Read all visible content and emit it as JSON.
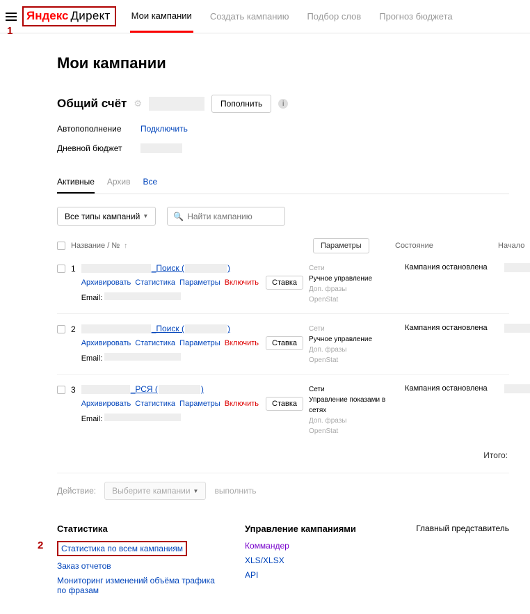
{
  "markers": {
    "one": "1",
    "two": "2"
  },
  "logo": {
    "brand": "Яндекс",
    "product": "Директ"
  },
  "nav": {
    "my_campaigns": "Мои кампании",
    "create": "Создать кампанию",
    "words": "Подбор слов",
    "budget": "Прогноз бюджета"
  },
  "page_title": "Мои кампании",
  "account": {
    "label": "Общий счёт",
    "refill": "Пополнить",
    "auto_label": "Автопополнение",
    "auto_action": "Подключить",
    "daily_label": "Дневной бюджет"
  },
  "tabs2": {
    "active": "Активные",
    "archive": "Архив",
    "all": "Все"
  },
  "filter": {
    "types": "Все типы кампаний",
    "search_ph": "Найти кампанию"
  },
  "thead": {
    "name": "Название / №",
    "params": "Параметры",
    "state": "Состояние",
    "start": "Начало"
  },
  "row_actions": {
    "archive": "Архивировать",
    "stats": "Статистика",
    "params": "Параметры",
    "enable": "Включить",
    "rate": "Ставка",
    "email": "Email:"
  },
  "params_block": {
    "net": "Сети",
    "manual": "Ручное управление",
    "netmanage": "Управление показами в сетях",
    "phrases": "Доп. фразы",
    "openstat": "OpenStat"
  },
  "campaigns": [
    {
      "num": "1",
      "suffix": "_Поиск (",
      "close": ")",
      "state": "Кампания остановлена",
      "type": "search"
    },
    {
      "num": "2",
      "suffix": "_Поиск (",
      "close": ")",
      "state": "Кампания остановлена",
      "type": "search"
    },
    {
      "num": "3",
      "suffix": "_РСЯ (",
      "close": ")",
      "state": "Кампания остановлена",
      "type": "rsya"
    }
  ],
  "total": "Итого:",
  "bulk": {
    "label": "Действие:",
    "select": "Выберите кампании",
    "exec": "выполнить"
  },
  "footer": {
    "stats_h": "Статистика",
    "stats_all": "Статистика по всем кампаниям",
    "reports": "Заказ отчетов",
    "monitoring": "Мониторинг изменений объёма трафика по фразам",
    "manage_h": "Управление кампаниями",
    "commander": "Коммандер",
    "xls": "XLS/XLSX",
    "api": "API",
    "rep": "Главный представитель"
  }
}
